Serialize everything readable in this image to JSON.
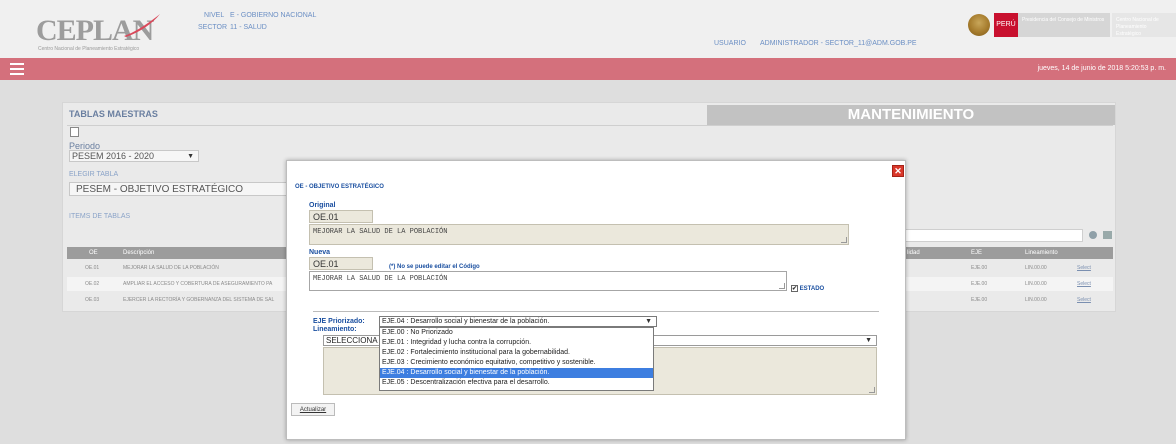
{
  "header": {
    "logo_text": "CEPLAN",
    "logo_sub": "Centro Nacional de Planeamiento Estratégico",
    "nivel_label": "NIVEL",
    "nivel_value": "E - GOBIERNO NACIONAL",
    "sector_label": "SECTOR",
    "sector_value": "11 - SALUD",
    "usuario_label": "USUARIO",
    "usuario_value": "ADMINISTRADOR - SECTOR_11@ADM.GOB.PE",
    "peru": "PERÚ",
    "pcm": "Presidencia del Consejo de Ministros",
    "ceplan_gov": "Centro Nacional de Planeamiento Estratégico"
  },
  "redbar": {
    "date": "jueves, 14 de junio de 2018 5:20:53 p. m."
  },
  "panel": {
    "title": "TABLAS MAESTRAS",
    "mant": "MANTENIMIENTO",
    "periodo_label": "Periodo",
    "periodo_value": "PESEM 2016 - 2020",
    "elegir_label": "ELEGIR TABLA",
    "elegir_value": "PESEM - OBJETIVO ESTRATÉGICO",
    "items_label": "ITEMS DE TABLAS",
    "headers": {
      "cod": "OE",
      "desc": "Descripción",
      "prio": "lidad",
      "eje": "EJE",
      "lin": "Lineamiento"
    },
    "rows": [
      {
        "cod": "OE.01",
        "desc": "MEJORAR LA SALUD DE LA POBLACIÓN",
        "eje": "EJE.00",
        "lin": "LIN.00.00",
        "sel": "Select"
      },
      {
        "cod": "OE.02",
        "desc": "AMPLIAR EL ACCESO Y COBERTURA DE ASEGURAMIENTO PA",
        "eje": "EJE.00",
        "lin": "LIN.00.00",
        "sel": "Select"
      },
      {
        "cod": "OE.03",
        "desc": "EJERCER LA RECTORÍA Y GOBERNANZA DEL SISTEMA DE SAL",
        "eje": "EJE.00",
        "lin": "LIN.00.00",
        "sel": "Select"
      }
    ]
  },
  "modal": {
    "title": "OE - OBJETIVO ESTRATÉGICO",
    "original_label": "Original",
    "original_code": "OE.01",
    "original_desc": "MEJORAR LA SALUD DE LA POBLACIÓN",
    "nueva_label": "Nueva",
    "nueva_code": "OE.01",
    "note": "(*) No se puede editar el Código",
    "nueva_desc": "MEJORAR LA SALUD DE LA POBLACIÓN",
    "checkbox_mark": "✔",
    "estado_label": "ESTADO",
    "eje_label": "EJE Priorizado:",
    "eje_value": "EJE.04 : Desarrollo social y bienestar de la población.",
    "lin_label": "Lineamiento:",
    "lin_value": "SELECCIONA",
    "options": [
      "EJE.00 : No Priorizado",
      "EJE.01 : Integridad y lucha contra la corrupción.",
      "EJE.02 : Fortalecimiento institucional para la gobernabilidad.",
      "EJE.03 : Crecimiento económico equitativo, competitivo y sostenible.",
      "EJE.04 : Desarrollo social y bienestar de la población.",
      "EJE.05 : Descentralización efectiva para el desarrollo."
    ],
    "selected_index": 4,
    "actualizar": "Actualizar"
  },
  "icons": {
    "arrow": "▼",
    "close": "✕"
  }
}
